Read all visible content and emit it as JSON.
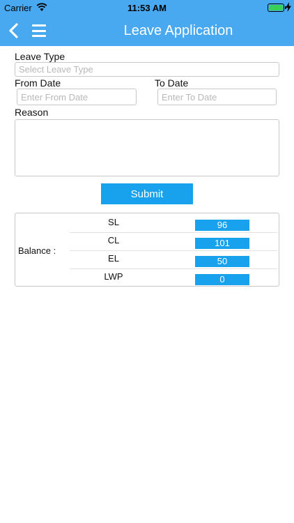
{
  "status": {
    "carrier": "Carrier",
    "time": "11:53 AM"
  },
  "nav": {
    "title": "Leave Application"
  },
  "form": {
    "leave_type_label": "Leave Type",
    "leave_type_placeholder": "Select Leave Type",
    "from_date_label": "From Date",
    "from_date_placeholder": "Enter From Date",
    "to_date_label": "To Date",
    "to_date_placeholder": "Enter To Date",
    "reason_label": "Reason",
    "submit_label": "Submit"
  },
  "balance": {
    "label": "Balance :",
    "rows": [
      {
        "type": "SL",
        "value": "96"
      },
      {
        "type": "CL",
        "value": "101"
      },
      {
        "type": "EL",
        "value": "50"
      },
      {
        "type": "LWP",
        "value": "0"
      }
    ]
  },
  "colors": {
    "accent": "#48a8f0",
    "button": "#18a2ee",
    "battery": "#39d05a"
  }
}
